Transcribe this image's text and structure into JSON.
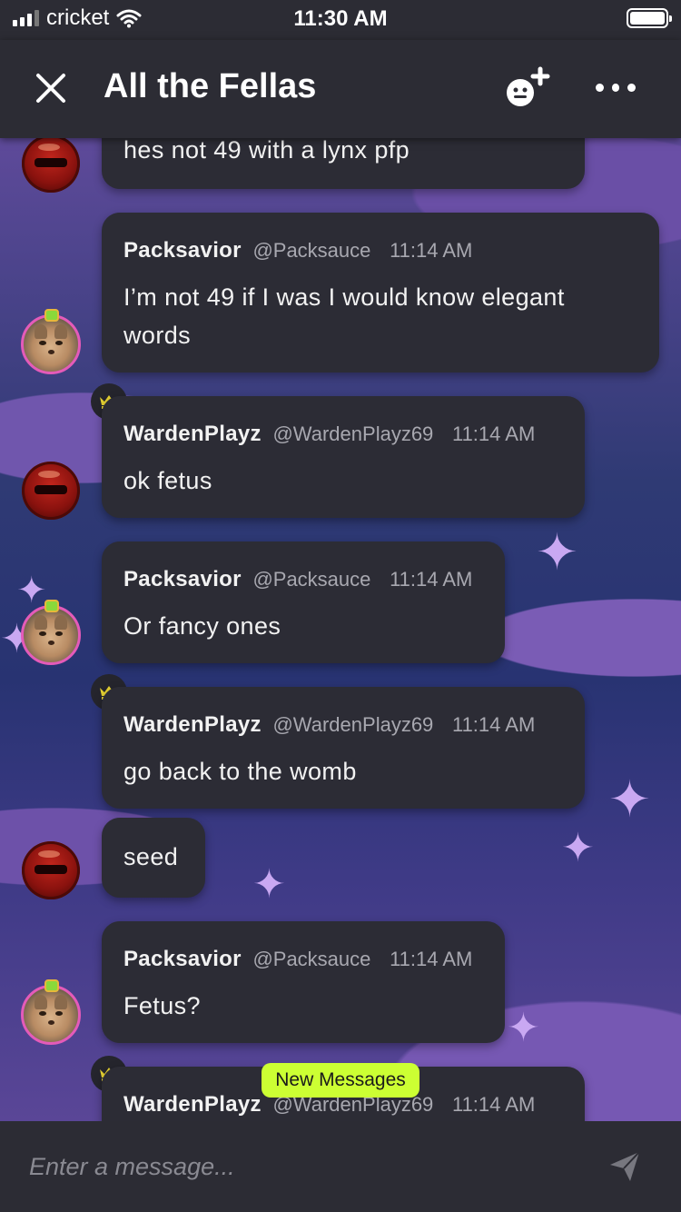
{
  "status_bar": {
    "carrier": "cricket",
    "time": "11:30 AM"
  },
  "header": {
    "title": "All the Fellas"
  },
  "messages": [
    {
      "text": "hes not 49 with a lynx pfp"
    },
    {
      "author": "Packsavior",
      "handle": "@Packsauce",
      "time": "11:14 AM",
      "text_line1": "I’m not 49 if I was I would know elegant",
      "text_line2": "words"
    },
    {
      "author": "WardenPlayz",
      "handle": "@WardenPlayz69",
      "time": "11:14 AM",
      "text": "ok fetus"
    },
    {
      "author": "Packsavior",
      "handle": "@Packsauce",
      "time": "11:14 AM",
      "text": "Or fancy ones"
    },
    {
      "author": "WardenPlayz",
      "handle": "@WardenPlayz69",
      "time": "11:14 AM",
      "text": "go back to the womb"
    },
    {
      "text": "seed"
    },
    {
      "author": "Packsavior",
      "handle": "@Packsauce",
      "time": "11:14 AM",
      "text": "Fetus?"
    },
    {
      "author": "WardenPlayz",
      "handle": "@WardenPlayz69",
      "time": "11:14 AM"
    }
  ],
  "new_messages_label": "New Messages",
  "composer": {
    "placeholder": "Enter a message..."
  },
  "colors": {
    "crown": "#e6d232",
    "new_messages_bg": "#ccff33",
    "avatar_ring": "#e45bb9",
    "bubble_bg": "#2c2c35"
  }
}
